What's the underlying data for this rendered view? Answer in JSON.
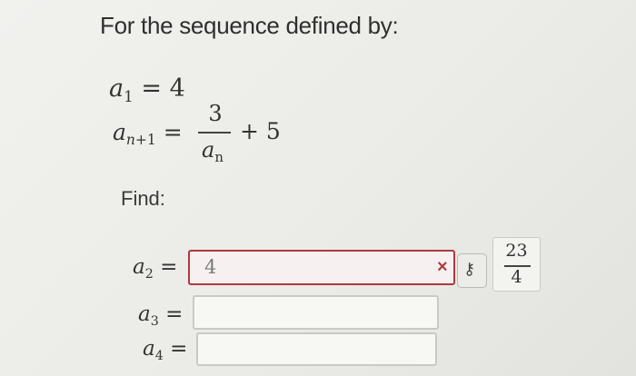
{
  "prompt": "For the sequence defined by:",
  "definition": {
    "a1_var": "a",
    "a1_index": "1",
    "a1_eq": "= 4",
    "rec_var": "a",
    "rec_index_var": "n",
    "rec_index_rest": "+1",
    "rec_eq": "=",
    "frac_num": "3",
    "frac_den_var": "a",
    "frac_den_index": "n",
    "rec_tail": "+ 5"
  },
  "find_label": "Find:",
  "answers": [
    {
      "var": "a",
      "index": "2",
      "eq": "=",
      "value": "4",
      "status": "incorrect"
    },
    {
      "var": "a",
      "index": "3",
      "eq": "=",
      "value": ""
    },
    {
      "var": "a",
      "index": "4",
      "eq": "=",
      "value": ""
    }
  ],
  "feedback": {
    "incorrect_mark": "×",
    "key_icon": "key-icon",
    "key_glyph": "⚷",
    "correct_answer_num": "23",
    "correct_answer_den": "4"
  },
  "colors": {
    "error": "#b0393f",
    "background": "#ececE8"
  }
}
